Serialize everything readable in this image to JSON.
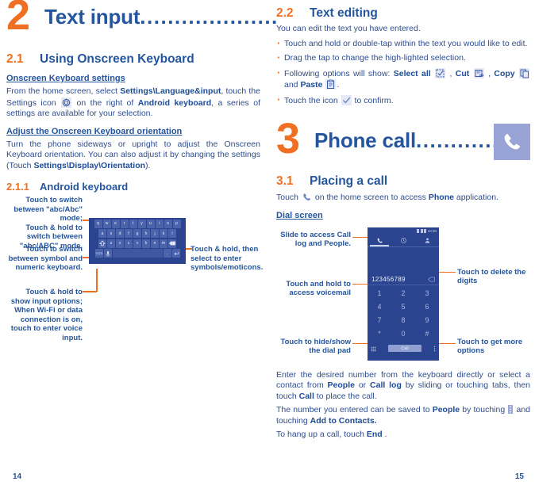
{
  "colors": {
    "accent_orange": "#f07023",
    "heading_blue": "#24559e",
    "body_blue": "#2e4d8f",
    "phone_bg": "#2b4490",
    "icon_tile": "#9aa3d6"
  },
  "left_page": {
    "chapter": {
      "number": "2",
      "title": "Text input",
      "dots": "...................."
    },
    "section_2_1": {
      "number": "2.1",
      "title": "Using Onscreen Keyboard"
    },
    "sub_settings_heading": "Onscreen Keyboard settings",
    "settings_para_1": "From the home screen, select ",
    "settings_bold_1": "Settings\\Language&input",
    "settings_para_2": ", touch the Settings icon ",
    "settings_para_3": " on the right of ",
    "settings_bold_2": "Android keyboard",
    "settings_para_4": ", a series of settings are available for your selection.",
    "sub_orientation_heading": "Adjust the Onscreen Keyboard orientation",
    "orientation_para_1": "Turn the phone sideways or upright to adjust the Onscreen Keyboard orientation. You can also adjust it by changing the settings (Touch ",
    "orientation_bold": "Settings\\Display\\Orientation",
    "orientation_para_2": ").",
    "section_2_1_1": {
      "number": "2.1.1",
      "title": "Android keyboard"
    },
    "annotations": {
      "switch_abc": "Touch to switch between \"abc/Abc\" mode;\nTouch & hold to switch between \"abc/ABC\" mode.",
      "switch_symbol": "Touch to switch between symbol and numeric keyboard.",
      "input_options": "Touch & hold to show input options;\nWhen Wi-Fi or data connection is on, touch to enter voice input.",
      "symbols_emoticons": "Touch & hold, then select to enter symbols/emoticons."
    },
    "keyboard": {
      "row1": [
        "q",
        "w",
        "e",
        "r",
        "t",
        "y",
        "u",
        "i",
        "o",
        "p"
      ],
      "row2": [
        "a",
        "s",
        "d",
        "f",
        "g",
        "h",
        "j",
        "k",
        "l"
      ],
      "row3": [
        "shift",
        "z",
        "x",
        "c",
        "v",
        "b",
        "n",
        "m",
        "backspace"
      ],
      "row4": [
        "?123",
        "mic",
        "space",
        ".",
        "return"
      ]
    },
    "page_number": "14"
  },
  "right_page": {
    "section_2_2": {
      "number": "2.2",
      "title": "Text editing"
    },
    "intro": "You can edit the text you have entered.",
    "bullets": [
      {
        "id": "edit-touch-hold",
        "text": "Touch and hold or double-tap within the text you would like to edit."
      },
      {
        "id": "edit-drag-tap",
        "text": "Drag the tap to change the high-lighted selection."
      },
      {
        "id": "edit-options",
        "prefix": "Following options will show: ",
        "b1": "Select all",
        "b2": "Cut",
        "b3": "Copy",
        "b4": "Paste",
        "sep_and": " and ",
        "suffix": "."
      },
      {
        "id": "edit-confirm",
        "prefix": "Touch the icon ",
        "suffix": " to confirm."
      }
    ],
    "chapter": {
      "number": "3",
      "title": "Phone call",
      "dots": "..............."
    },
    "section_3_1": {
      "number": "3.1",
      "title": "Placing a call"
    },
    "touch_para_1": "Touch ",
    "touch_para_2": " on the home screen to access ",
    "touch_bold": "Phone",
    "touch_para_3": " application.",
    "dial_screen_heading": "Dial screen",
    "annotations": {
      "slide_access": "Slide to access ",
      "slide_access_b1": "Call log",
      "slide_access_mid": " and ",
      "slide_access_b2": "People",
      "slide_access_end": ".",
      "voicemail": "Touch and hold to access voicemail",
      "hide_show": "Touch to hide/show the dial pad",
      "delete_digits": "Touch to delete the digits",
      "more_options": "Touch to get more options"
    },
    "dial_screen": {
      "entered_number": "123456789",
      "tabs": [
        "phone-tab",
        "recents-tab",
        "contacts-tab"
      ],
      "keypad": [
        [
          "1",
          "2",
          "3"
        ],
        [
          "4",
          "5",
          "6"
        ],
        [
          "7",
          "8",
          "9"
        ],
        [
          "*",
          "0",
          "#"
        ]
      ],
      "call_button": "Call"
    },
    "para_enter_1": "Enter the desired number from the keyboard directly or select a contact from ",
    "para_enter_b1": "People",
    "para_enter_2": " or ",
    "para_enter_b2": "Call log",
    "para_enter_3": " by sliding or touching tabs, then touch ",
    "para_enter_b3": "Call",
    "para_enter_4": " to place the call.",
    "para_save_1": "The number you entered can be saved to ",
    "para_save_b1": "People",
    "para_save_2": " by touching ",
    "para_save_3": " and touching ",
    "para_save_b2": "Add to Contacts.",
    "para_hangup_1": "To hang up a call, touch ",
    "para_hangup_b": "End",
    "para_hangup_2": " .",
    "page_number": "15"
  }
}
